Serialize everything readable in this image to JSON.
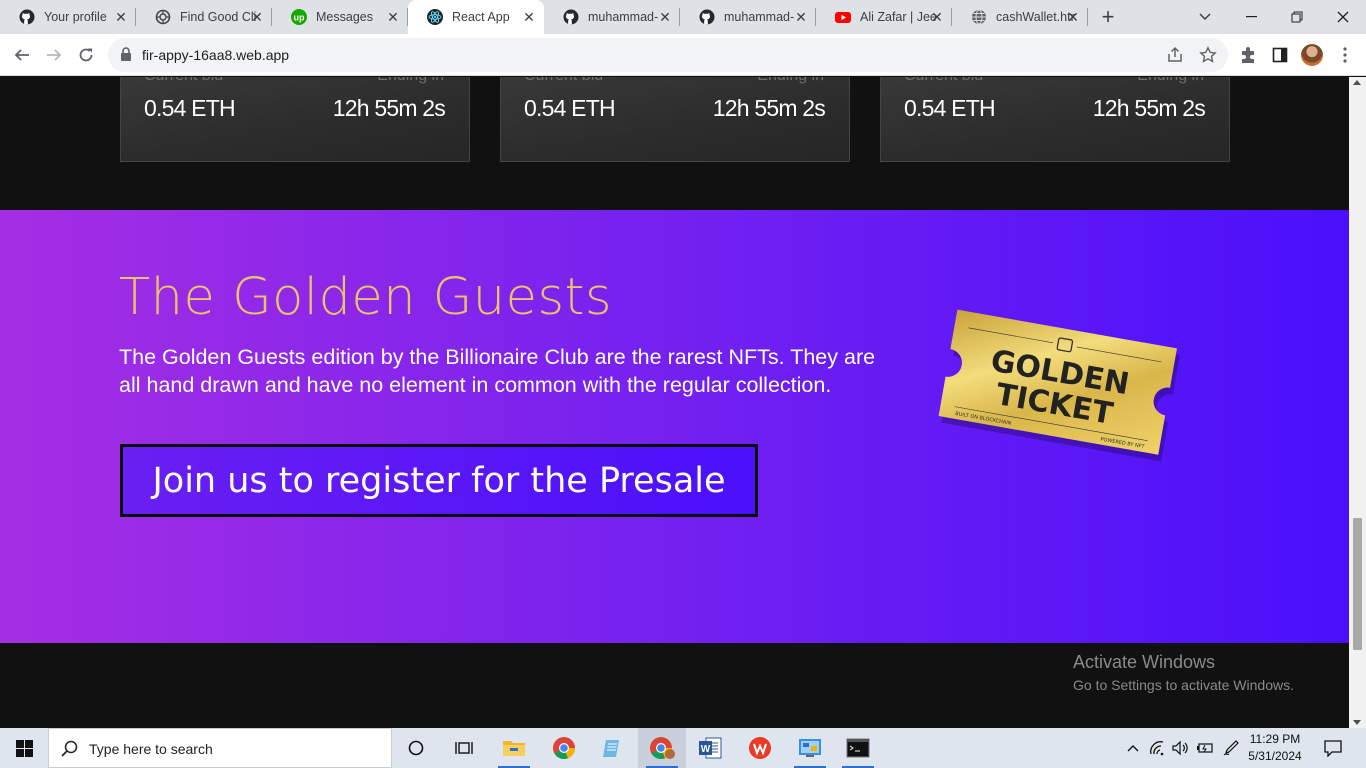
{
  "browser": {
    "tabs": [
      {
        "title": "Your profile",
        "icon": "github-icon",
        "active": false
      },
      {
        "title": "Find Good Cli",
        "icon": "openai-icon",
        "active": false
      },
      {
        "title": "Messages",
        "icon": "upwork-icon",
        "active": false
      },
      {
        "title": "React App",
        "icon": "react-icon",
        "active": true
      },
      {
        "title": "muhammad-",
        "icon": "github-icon",
        "active": false
      },
      {
        "title": "muhammad-",
        "icon": "github-icon",
        "active": false
      },
      {
        "title": "Ali Zafar | Jee",
        "icon": "youtube-icon",
        "active": false
      },
      {
        "title": "cashWallet.htr",
        "icon": "globe-icon",
        "active": false
      }
    ],
    "url": "fir-appy-16aa8.web.app"
  },
  "page": {
    "cards": [
      {
        "label_left": "Current bid",
        "label_right": "Ending in",
        "price": "0.54 ETH",
        "countdown": "12h 55m 2s"
      },
      {
        "label_left": "Current bid",
        "label_right": "Ending in",
        "price": "0.54 ETH",
        "countdown": "12h 55m 2s"
      },
      {
        "label_left": "Current bid",
        "label_right": "Ending in",
        "price": "0.54 ETH",
        "countdown": "12h 55m 2s"
      }
    ],
    "promo": {
      "title": "The Golden Guests",
      "description": "The Golden Guests edition by the Billionaire Club are the rarest NFTs. They are all hand drawn and have no element in common with the regular collection.",
      "cta_label": "Join us to register for the Presale",
      "ticket_line1": "GOLDEN",
      "ticket_line2": "TICKET",
      "ticket_left_small": "BUILT ON BLOCKCHAIN",
      "ticket_right_small": "POWERED BY NFT",
      "colors": {
        "title": "#e9c36a",
        "gradient_start": "#a52ee3",
        "gradient_end": "#4a10fb",
        "ticket_gold": "#e3c24f"
      }
    }
  },
  "watermark": {
    "line1": "Activate Windows",
    "line2": "Go to Settings to activate Windows."
  },
  "taskbar": {
    "search_placeholder": "Type here to search",
    "apps": [
      "cortana-icon",
      "task-view-icon",
      "file-explorer-icon",
      "chrome-icon",
      "notepad-icon",
      "chrome-profile-icon",
      "word-icon",
      "wps-office-icon",
      "control-panel-icon",
      "terminal-icon"
    ],
    "time": "11:29 PM",
    "date": "5/31/2024"
  }
}
